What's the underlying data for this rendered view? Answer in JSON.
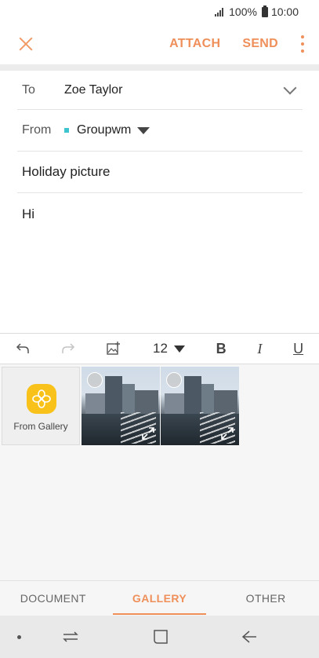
{
  "status_bar": {
    "battery": "100%",
    "time": "10:00"
  },
  "action_bar": {
    "attach_label": "ATTACH",
    "send_label": "SEND"
  },
  "to": {
    "label": "To",
    "value": "Zoe Taylor"
  },
  "from": {
    "label": "From",
    "value": "Groupwm"
  },
  "subject": "Holiday picture",
  "body": "Hi",
  "format_bar": {
    "font_size": "12",
    "bold": "B",
    "italic": "I",
    "underline": "U"
  },
  "gallery": {
    "from_gallery_label": "From Gallery",
    "photo_count": 2
  },
  "tabs": [
    {
      "label": "DOCUMENT",
      "active": false
    },
    {
      "label": "GALLERY",
      "active": true
    },
    {
      "label": "OTHER",
      "active": false
    }
  ],
  "colors": {
    "accent": "#ef8f5a",
    "from_dot": "#3ec4cf",
    "gallery_icon": "#f9c21a"
  },
  "icons": [
    "close-icon",
    "more-icon",
    "chevron-down-icon",
    "undo-icon",
    "redo-icon",
    "insert-image-icon",
    "gallery-flower-icon",
    "expand-icon"
  ]
}
